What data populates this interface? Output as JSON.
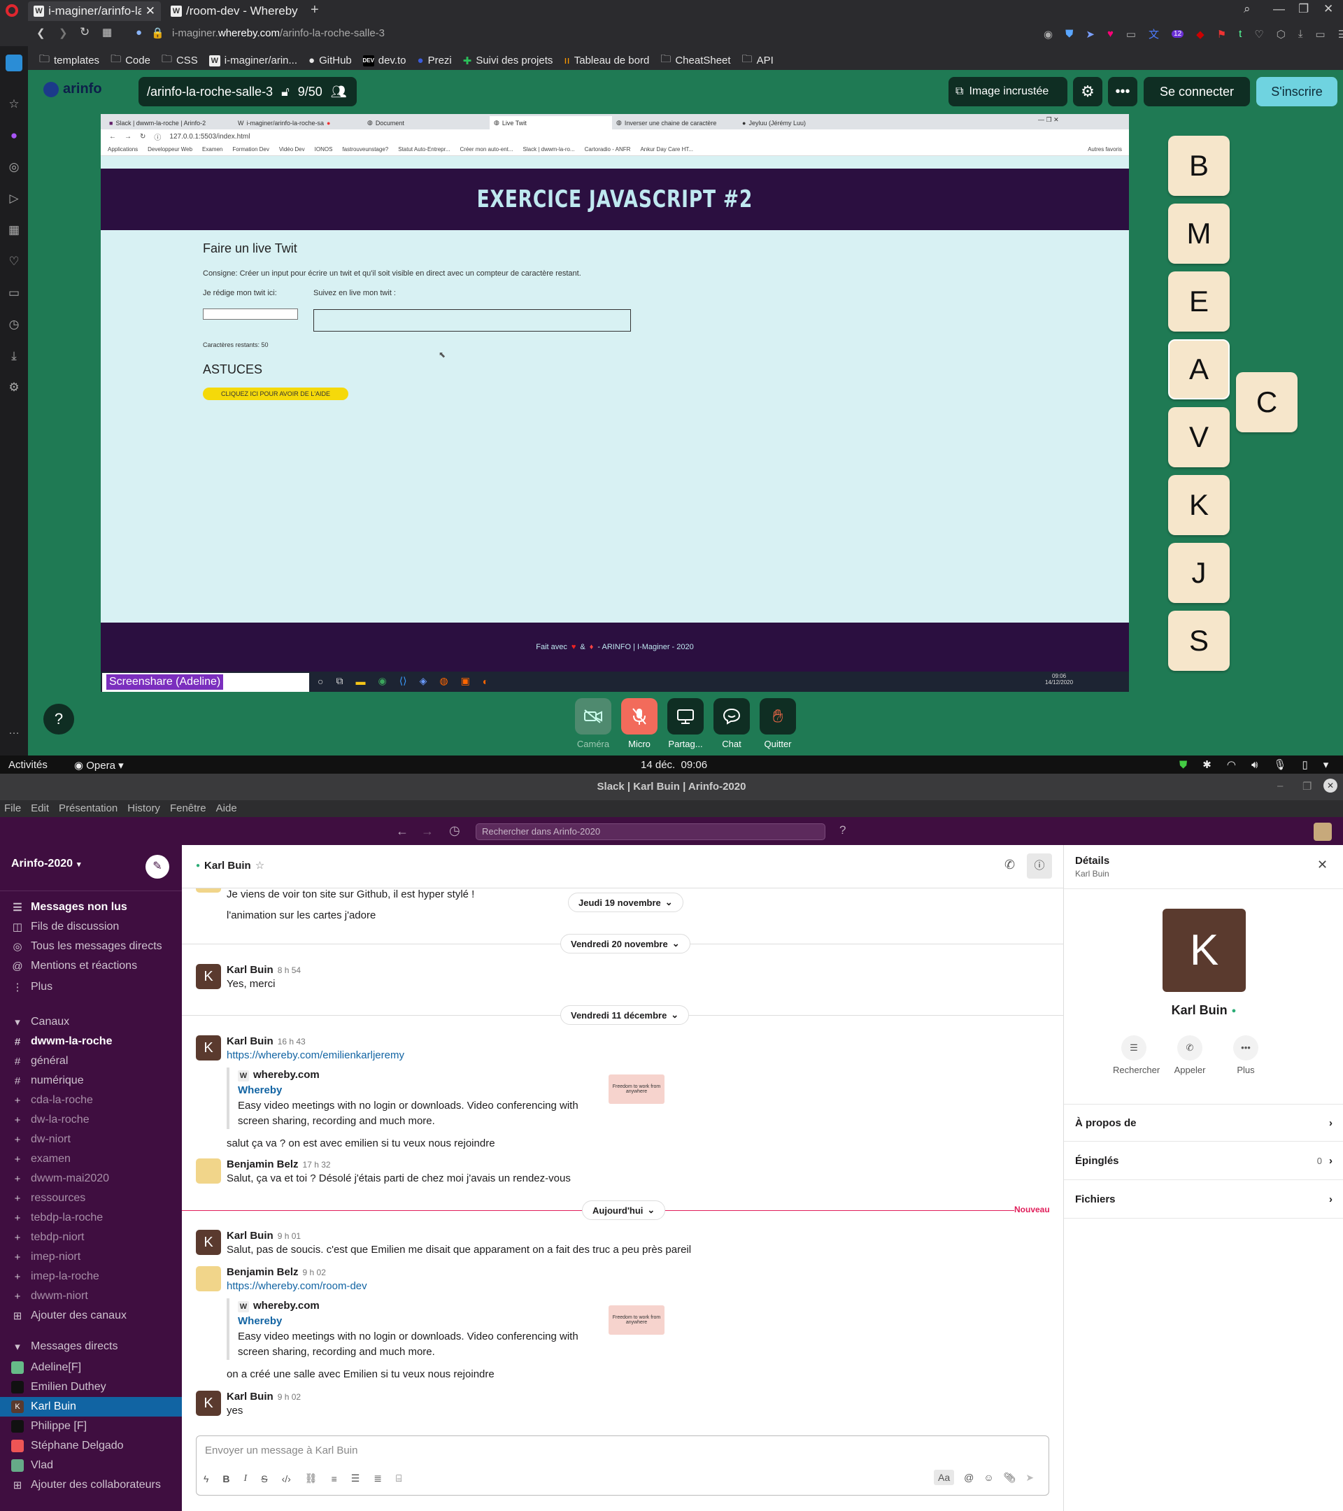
{
  "browser": {
    "tabs": [
      "i-maginer/arinfo-la-r",
      "/room-dev - Whereby"
    ],
    "url_prefix": "i-maginer.",
    "url_host": "whereby.com",
    "url_path": "/arinfo-la-roche-salle-3",
    "bookmarks": [
      "templates",
      "Code",
      "CSS",
      "i-maginer/arin...",
      "GitHub",
      "dev.to",
      "Prezi",
      "Suivi des projets",
      "Tableau de bord",
      "CheatSheet",
      "API"
    ],
    "ext_badge": "12"
  },
  "whereby": {
    "logo": "arinfo",
    "room": "/arinfo-la-roche-salle-3",
    "count": "9/50",
    "pip_label": "Image incrustée",
    "login": "Se connecter",
    "signup": "S'inscrire",
    "tiles": [
      "B",
      "M",
      "E",
      "A",
      "V",
      "K",
      "J",
      "S"
    ],
    "tile_extra": "C",
    "help": "?",
    "controls": [
      "Caméra",
      "Micro",
      "Partag...",
      "Chat",
      "Quitter"
    ],
    "screenshare_label": "Screenshare (Adeline)"
  },
  "shared": {
    "tabs": [
      "Slack | dwwm-la-roche | Arinfo-2",
      "i-maginer/arinfo-la-roche-sa",
      "Document",
      "Live Twit",
      "Inverser une chaine de caractère",
      "Jeyluu (Jérémy Luu)"
    ],
    "url": "127.0.0.1:5503/index.html",
    "bookmarks": [
      "Applications",
      "Developpeur Web",
      "Examen",
      "Formation Dev",
      "Vidéo Dev",
      "IONOS",
      "fastrouveunstage?",
      "Statut Auto-Entrepr...",
      "Créer mon auto-ent...",
      "Slack | dwwm-la-ro...",
      "Cartoradio - ANFR",
      "Ankur Day Care HT...",
      "Autres favoris"
    ],
    "banner": "EXERCICE JAVASCRIPT #2",
    "heading": "Faire un live Twit",
    "consigne": "Consigne: Créer un input pour écrire un twit et qu'il soit visible en direct avec un compteur de caractère restant.",
    "label1": "Je rédige mon twit ici:",
    "label2": "Suivez en live mon twit :",
    "counter": "Caractères restants: 50",
    "astuces": "ASTUCES",
    "aide_btn": "CLIQUEZ ICI POUR AVOIR DE L'AIDE",
    "footer_a": "Fait avec",
    "footer_b": "&",
    "footer_c": "- ARINFO | I-Maginer - 2020",
    "clock_time": "09:06",
    "clock_date": "14/12/2020"
  },
  "gnome": {
    "activities": "Activités",
    "app": "Opera",
    "clock": "14 déc.  09:06"
  },
  "slack": {
    "title": "Slack | Karl Buin | Arinfo-2020",
    "menu": [
      "File",
      "Edit",
      "Présentation",
      "History",
      "Fenêtre",
      "Aide"
    ],
    "search": "Rechercher dans Arinfo-2020",
    "workspace": "Arinfo-2020",
    "nav": [
      "Messages non lus",
      "Fils de discussion",
      "Tous les messages directs",
      "Mentions et réactions",
      "Plus"
    ],
    "channels_header": "Canaux",
    "channels": [
      "dwwm-la-roche",
      "général",
      "numérique",
      "cda-la-roche",
      "dw-la-roche",
      "dw-niort",
      "examen",
      "dwwm-mai2020",
      "ressources",
      "tebdp-la-roche",
      "tebdp-niort",
      "imep-niort",
      "imep-la-roche",
      "dwwm-niort"
    ],
    "add_channels": "Ajouter des canaux",
    "dm_header": "Messages directs",
    "dms": [
      "Adeline[F]",
      "Emilien Duthey",
      "Karl Buin",
      "Philippe [F]",
      "Stéphane Delgado",
      "Vlad"
    ],
    "add_collab": "Ajouter des collaborateurs",
    "chat_name": "Karl Buin",
    "dates": [
      "Jeudi 19 novembre",
      "Vendredi 20 novembre",
      "Vendredi 11 décembre",
      "Aujourd'hui"
    ],
    "nouveau": "Nouveau",
    "top_lines": [
      "Je viens de voir ton site sur Github, il est hyper stylé !",
      "l'animation sur les cartes j'adore"
    ],
    "messages": [
      {
        "author": "Karl Buin",
        "time": "8 h 54",
        "text": "Yes, merci"
      },
      {
        "author": "Karl Buin",
        "time": "16 h 43",
        "text": "https://whereby.com/emilienkarljeremy"
      },
      {
        "author": "Benjamin Belz",
        "time": "17 h 32",
        "text": "Salut, ça va et toi ? Désolé j'étais parti de chez moi j'avais un rendez-vous"
      },
      {
        "author": "Karl Buin",
        "time": "9 h 01",
        "text": "Salut, pas de soucis. c'est que Emilien me disait que apparament on a fait des truc a peu près pareil"
      },
      {
        "author": "Benjamin Belz",
        "time": "9 h 02",
        "text": "https://whereby.com/room-dev"
      },
      {
        "author": "Karl Buin",
        "time": "9 h 02",
        "text": "yes"
      }
    ],
    "unfurl_site": "whereby.com",
    "unfurl_title": "Whereby",
    "unfurl_desc1": "Easy video meetings with no login or downloads. Video conferencing with",
    "unfurl_desc2": "screen sharing, recording and much more.",
    "thumb_text": "Freedom to work from anywhere",
    "followup1": "salut ça va ? on est avec emilien si tu veux nous rejoindre",
    "followup2": "on a créé une salle avec Emilien si tu veux nous rejoindre",
    "composer": "Envoyer un message à Karl Buin",
    "details": {
      "title": "Détails",
      "subtitle": "Karl Buin",
      "initial": "K",
      "name": "Karl Buin",
      "actions": [
        "Rechercher",
        "Appeler",
        "Plus"
      ],
      "rows": [
        "À propos de",
        "Épinglés",
        "Fichiers"
      ],
      "pinned": "0"
    }
  }
}
